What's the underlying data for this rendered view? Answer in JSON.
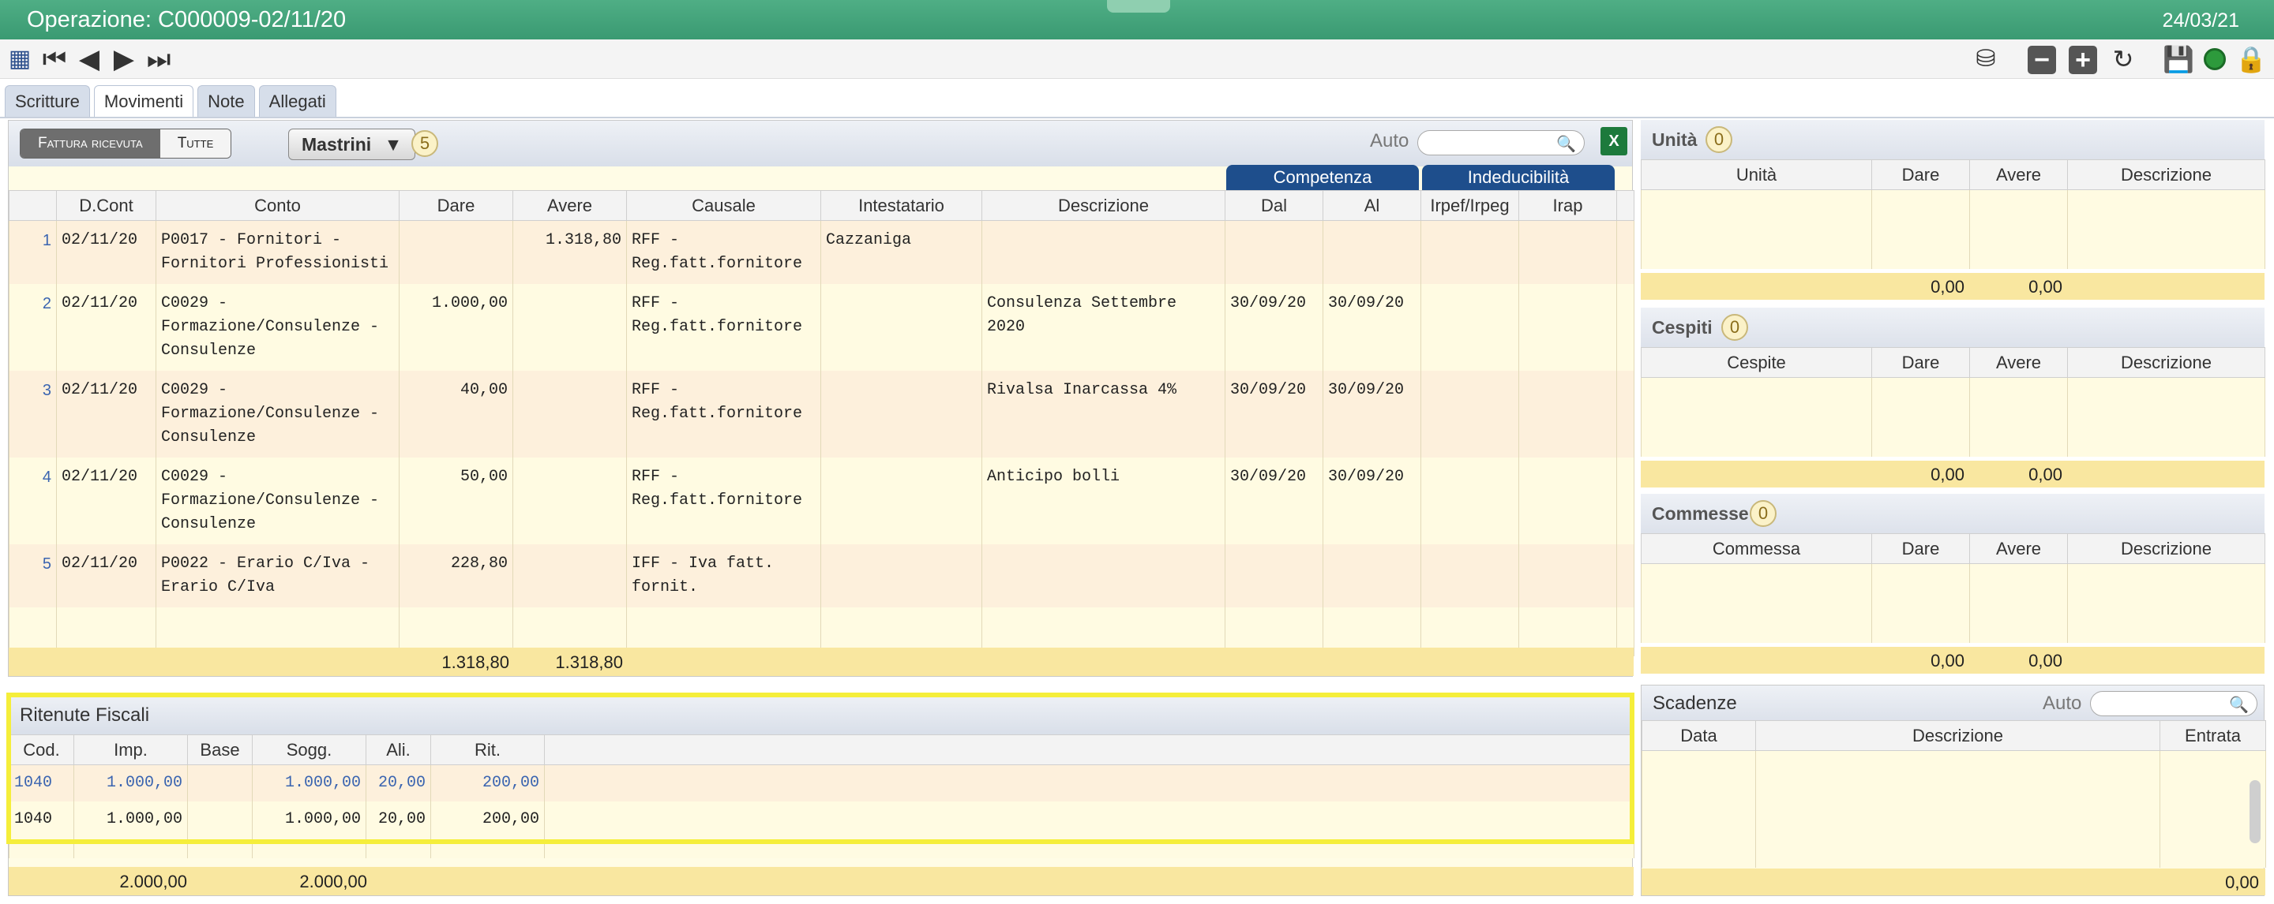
{
  "window": {
    "title": "Operazione: C000009-02/11/20",
    "date": "24/03/21"
  },
  "tabs": [
    "Scritture",
    "Movimenti",
    "Note",
    "Allegati"
  ],
  "toolbar": {
    "filter_on": "Fattura ricevuta",
    "filter_off": "Tutte",
    "mastrini_label": "Mastrini",
    "mastrini_count": "5",
    "search_label": "Auto"
  },
  "main_table": {
    "groups": {
      "competenza": "Competenza",
      "indeducibilita": "Indeducibilità"
    },
    "headers": [
      "D.Cont",
      "Conto",
      "Dare",
      "Avere",
      "Causale",
      "Intestatario",
      "Descrizione",
      "Dal",
      "Al",
      "Irpef/Irpeg",
      "Irap"
    ],
    "rows": [
      {
        "n": "1",
        "dcont": "02/11/20",
        "conto": "P0017 - Fornitori -\nFornitori Professionisti",
        "dare": "",
        "avere": "1.318,80",
        "causale": "RFF -\nReg.fatt.fornitore",
        "intestatario": "Cazzaniga",
        "descrizione": "",
        "dal": "",
        "al": ""
      },
      {
        "n": "2",
        "dcont": "02/11/20",
        "conto": "C0029 -\nFormazione/Consulenze -\nConsulenze",
        "dare": "1.000,00",
        "avere": "",
        "causale": "RFF -\nReg.fatt.fornitore",
        "intestatario": "",
        "descrizione": "Consulenza Settembre\n2020",
        "dal": "30/09/20",
        "al": "30/09/20"
      },
      {
        "n": "3",
        "dcont": "02/11/20",
        "conto": "C0029 -\nFormazione/Consulenze -\nConsulenze",
        "dare": "40,00",
        "avere": "",
        "causale": "RFF -\nReg.fatt.fornitore",
        "intestatario": "",
        "descrizione": "Rivalsa Inarcassa 4%",
        "dal": "30/09/20",
        "al": "30/09/20"
      },
      {
        "n": "4",
        "dcont": "02/11/20",
        "conto": "C0029 -\nFormazione/Consulenze -\nConsulenze",
        "dare": "50,00",
        "avere": "",
        "causale": "RFF -\nReg.fatt.fornitore",
        "intestatario": "",
        "descrizione": "Anticipo bolli",
        "dal": "30/09/20",
        "al": "30/09/20"
      },
      {
        "n": "5",
        "dcont": "02/11/20",
        "conto": "P0022 - Erario C/Iva -\nErario C/Iva",
        "dare": "228,80",
        "avere": "",
        "causale": "IFF - Iva fatt.\nfornit.",
        "intestatario": "",
        "descrizione": "",
        "dal": "",
        "al": ""
      }
    ],
    "total_dare": "1.318,80",
    "total_avere": "1.318,80"
  },
  "ritenute": {
    "title": "Ritenute Fiscali",
    "headers": [
      "Cod.",
      "Imp.",
      "Base",
      "Sogg.",
      "Ali.",
      "Rit."
    ],
    "rows": [
      [
        "1040",
        "1.000,00",
        "",
        "1.000,00",
        "20,00",
        "200,00"
      ],
      [
        "1040",
        "1.000,00",
        "",
        "1.000,00",
        "20,00",
        "200,00"
      ]
    ],
    "total_imp": "2.000,00",
    "total_sogg": "2.000,00"
  },
  "side": {
    "unita": {
      "title": "Unità",
      "count": "0",
      "headers": [
        "Unità",
        "Dare",
        "Avere",
        "Descrizione"
      ],
      "dare": "0,00",
      "avere": "0,00"
    },
    "cespiti": {
      "title": "Cespiti",
      "count": "0",
      "headers": [
        "Cespite",
        "Dare",
        "Avere",
        "Descrizione"
      ],
      "dare": "0,00",
      "avere": "0,00"
    },
    "commesse": {
      "title": "Commesse",
      "count": "0",
      "headers": [
        "Commessa",
        "Dare",
        "Avere",
        "Descrizione"
      ],
      "dare": "0,00",
      "avere": "0,00"
    },
    "scadenze": {
      "title": "Scadenze",
      "search_label": "Auto",
      "headers": [
        "Data",
        "Descrizione",
        "Entrata"
      ],
      "total": "0,00"
    }
  }
}
